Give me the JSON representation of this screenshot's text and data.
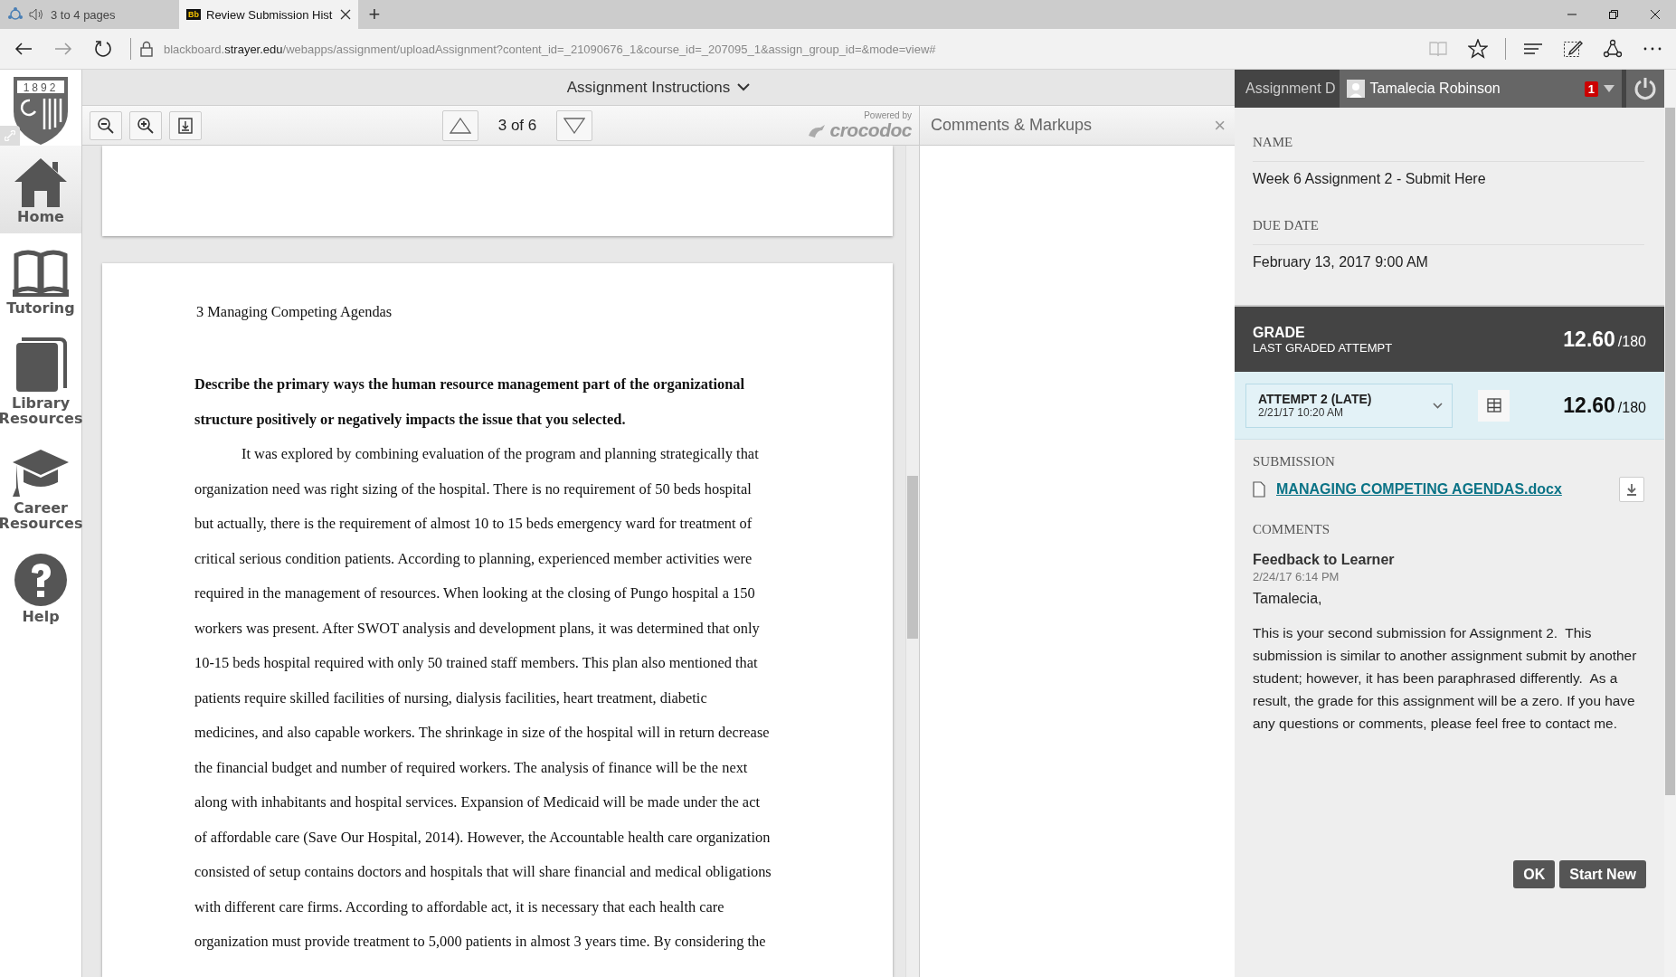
{
  "browser": {
    "tabs": [
      {
        "title": "3 to 4 pages",
        "selected": false,
        "audio": true
      },
      {
        "title": "Review Submission Hist",
        "selected": true,
        "audio": false,
        "favicon": "Bb"
      }
    ],
    "new_tab": "+",
    "address": {
      "host_prefix": "blackboard.",
      "domain": "strayer.edu",
      "path": "/webapps/assignment/uploadAssignment?content_id=_21090676_1&course_id=_207095_1&assign_group_id=&mode=view#"
    }
  },
  "sidebar": {
    "logo_year": "1892",
    "items": [
      {
        "label": "Home",
        "kind": "home",
        "selected": true
      },
      {
        "label": "Tutoring",
        "kind": "book",
        "selected": false
      },
      {
        "label": "Library Resources",
        "kind": "library",
        "selected": false
      },
      {
        "label": "Career Resources",
        "kind": "cap",
        "selected": false
      },
      {
        "label": "Help",
        "kind": "help",
        "selected": false
      }
    ]
  },
  "viewer": {
    "header": "Assignment Instructions",
    "page_indicator": "3 of 6",
    "powered_by": "Powered by",
    "brand": "crocodoc",
    "document": {
      "heading": "3 Managing Competing Agendas",
      "question_lines": [
        "Describe the primary ways the human resource management part of the organizational",
        "structure positively or negatively impacts the issue that you selected."
      ],
      "body_lines": [
        "It was explored by combining evaluation of the program and planning strategically that",
        "organization need was right sizing of the hospital. There is no requirement of 50 beds hospital",
        "but actually, there is the requirement of almost 10 to 15 beds emergency ward for treatment of",
        "critical serious condition patients. According to planning, experienced member activities were",
        "required in the management of resources. When looking at the closing of Pungo hospital a 150",
        "workers was present. After SWOT analysis and development plans, it was determined that only",
        "10-15 beds hospital required with only 50 trained staff members. This plan also mentioned that",
        "patients require skilled facilities of nursing, dialysis facilities, heart treatment, diabetic",
        "medicines, and also capable workers. The shrinkage in size of the hospital will in return decrease",
        "the financial budget and number of required workers. The analysis of finance will be the next",
        "along with inhabitants and hospital services. Expansion of Medicaid will be made under the act",
        "of affordable care (Save Our Hospital, 2014). However, the Accountable health care organization",
        "consisted of setup contains doctors and hospitals that will share financial and medical obligations",
        "with different care firms. According to affordable act, it is necessary that each health care",
        "organization must provide treatment to 5,000 patients in almost 3 years time. By considering the"
      ]
    }
  },
  "comments_pane": {
    "title": "Comments & Markups",
    "close": "×"
  },
  "panel": {
    "tab": "Assignment D",
    "user": "Tamalecia Robinson",
    "notifications": "1",
    "name_label": "NAME",
    "name": "Week 6 Assignment 2 - Submit Here",
    "due_label": "DUE DATE",
    "due": "February 13, 2017 9:00 AM",
    "grade": {
      "title": "GRADE",
      "subtitle": "LAST GRADED ATTEMPT",
      "score": "12.60",
      "out_of": "/180"
    },
    "attempt": {
      "label": "ATTEMPT 2 (LATE)",
      "date": "2/21/17 10:20 AM",
      "score": "12.60",
      "out_of": "/180"
    },
    "submission_label": "SUBMISSION",
    "file": "MANAGING COMPETING AGENDAS.docx",
    "comments_label": "COMMENTS",
    "feedback": {
      "title": "Feedback to Learner",
      "date": "2/24/17 6:14 PM",
      "greeting": "Tamalecia,",
      "body": "This is your second submission for Assignment 2.  This submission is similar to another assignment submit by another student; however, it has been paraphrased differently.  As a result, the grade for this assignment will be a zero. If you have any questions or comments, please feel free to contact me."
    },
    "buttons": [
      "OK",
      "Start New"
    ]
  }
}
